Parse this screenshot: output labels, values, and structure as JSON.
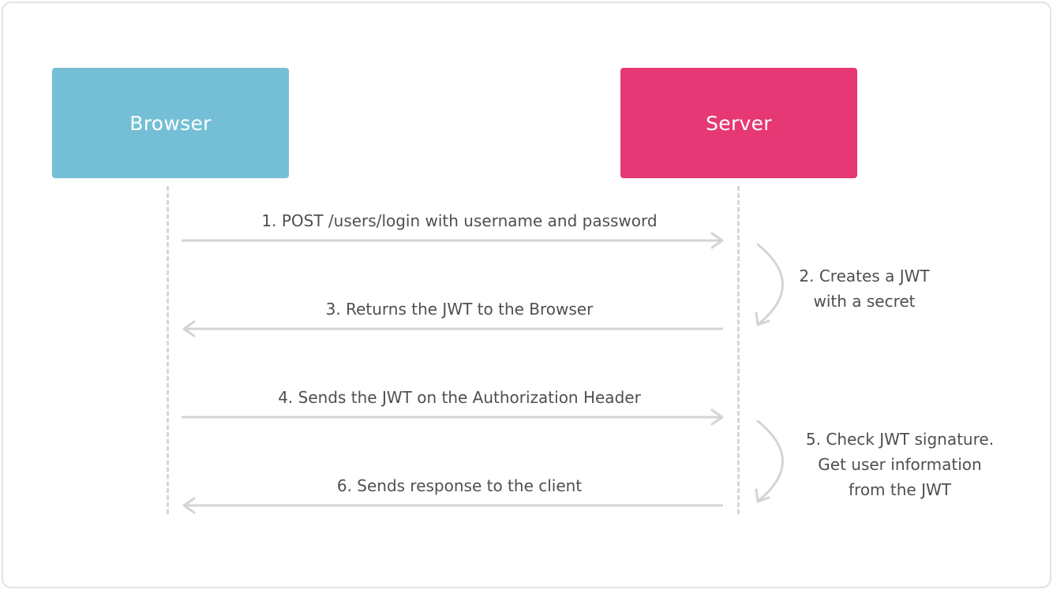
{
  "actors": {
    "browser": {
      "label": "Browser",
      "color": "#74bfd5"
    },
    "server": {
      "label": "Server",
      "color": "#e63874"
    }
  },
  "messages": [
    {
      "label": "1. POST /users/login with username and password",
      "direction": "browser-to-server"
    },
    {
      "label": "3. Returns the JWT to the Browser",
      "direction": "server-to-browser"
    },
    {
      "label": "4. Sends the JWT on the Authorization Header",
      "direction": "browser-to-server"
    },
    {
      "label": "6. Sends response to the client",
      "direction": "server-to-browser"
    }
  ],
  "server_notes": [
    {
      "lines": [
        "2. Creates a JWT",
        "with a secret"
      ]
    },
    {
      "lines": [
        "5. Check JWT signature.",
        "Get user information",
        "from the JWT"
      ]
    }
  ],
  "colors": {
    "arrow": "#d4d4d4",
    "lifeline": "#d6d6d6",
    "text": "#4f4f4f"
  }
}
